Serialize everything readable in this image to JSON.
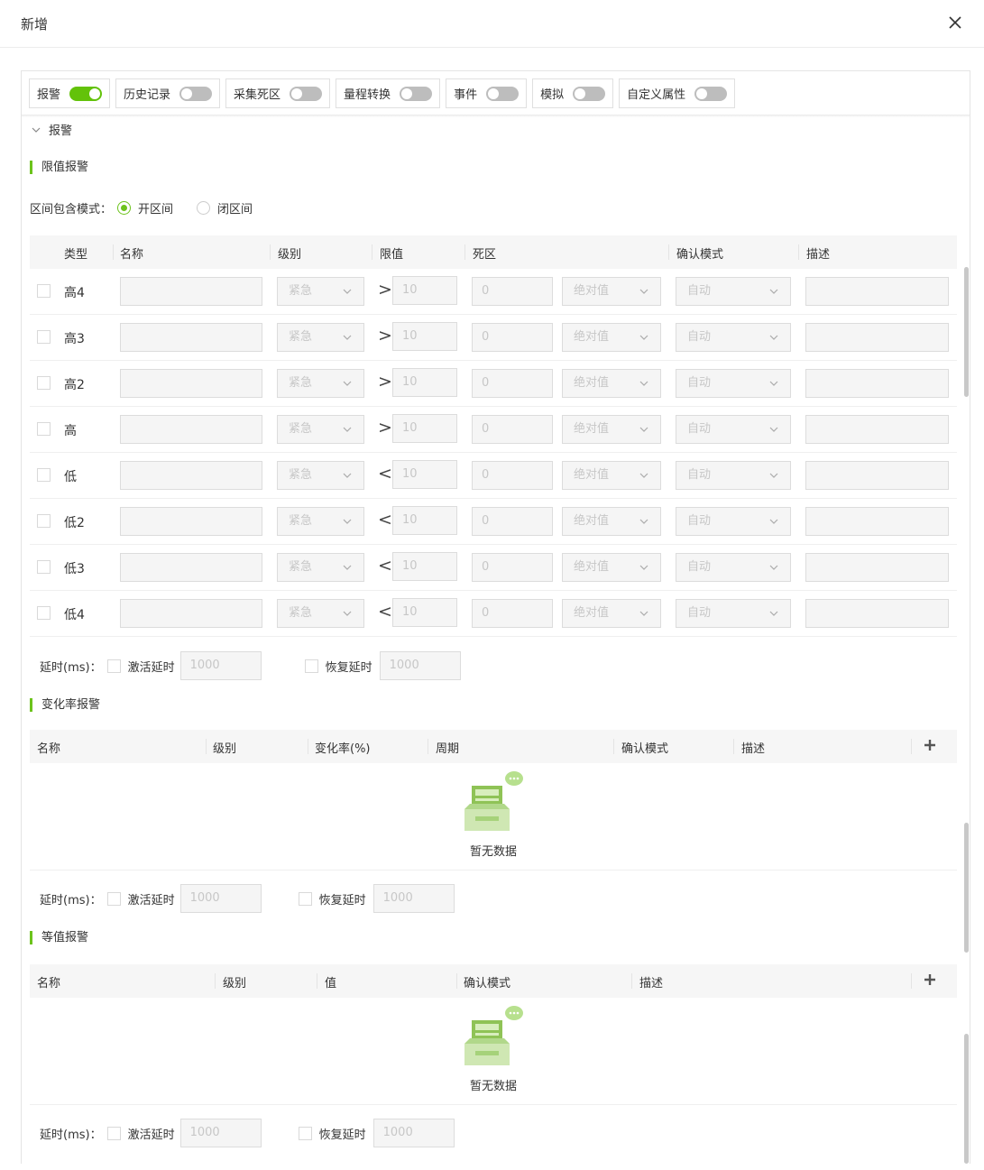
{
  "dialog": {
    "title": "新增",
    "close_icon": "close-icon"
  },
  "switches": [
    {
      "label": "报警",
      "on": true
    },
    {
      "label": "历史记录",
      "on": false
    },
    {
      "label": "采集死区",
      "on": false
    },
    {
      "label": "量程转换",
      "on": false
    },
    {
      "label": "事件",
      "on": false
    },
    {
      "label": "模拟",
      "on": false
    },
    {
      "label": "自定义属性",
      "on": false
    }
  ],
  "section": {
    "label": "报警"
  },
  "limit": {
    "title": "限值报警",
    "mode_label": "区间包含模式：",
    "mode_open": "开区间",
    "mode_closed": "闭区间",
    "columns": [
      "类型",
      "名称",
      "级别",
      "限值",
      "死区",
      "确认模式",
      "描述"
    ],
    "rows": [
      {
        "type": "高4",
        "op": ">"
      },
      {
        "type": "高3",
        "op": ">"
      },
      {
        "type": "高2",
        "op": ">"
      },
      {
        "type": "高",
        "op": ">"
      },
      {
        "type": "低",
        "op": "<"
      },
      {
        "type": "低2",
        "op": "<"
      },
      {
        "type": "低3",
        "op": "<"
      },
      {
        "type": "低4",
        "op": "<"
      }
    ],
    "level_value": "紧急",
    "limit_value": "10",
    "deadband_value": "0",
    "deadband_mode": "绝对值",
    "confirm_value": "自动"
  },
  "delay": {
    "label": "延时(ms)：",
    "activate_label": "激活延时",
    "recover_label": "恢复延时",
    "value": "1000"
  },
  "rate": {
    "title": "变化率报警",
    "columns": [
      "名称",
      "级别",
      "变化率(%)",
      "周期",
      "确认模式",
      "描述"
    ],
    "empty": "暂无数据"
  },
  "equal": {
    "title": "等值报警",
    "columns": [
      "名称",
      "级别",
      "值",
      "确认模式",
      "描述"
    ],
    "empty": "暂无数据"
  },
  "colors": {
    "accent": "#63c20a"
  }
}
